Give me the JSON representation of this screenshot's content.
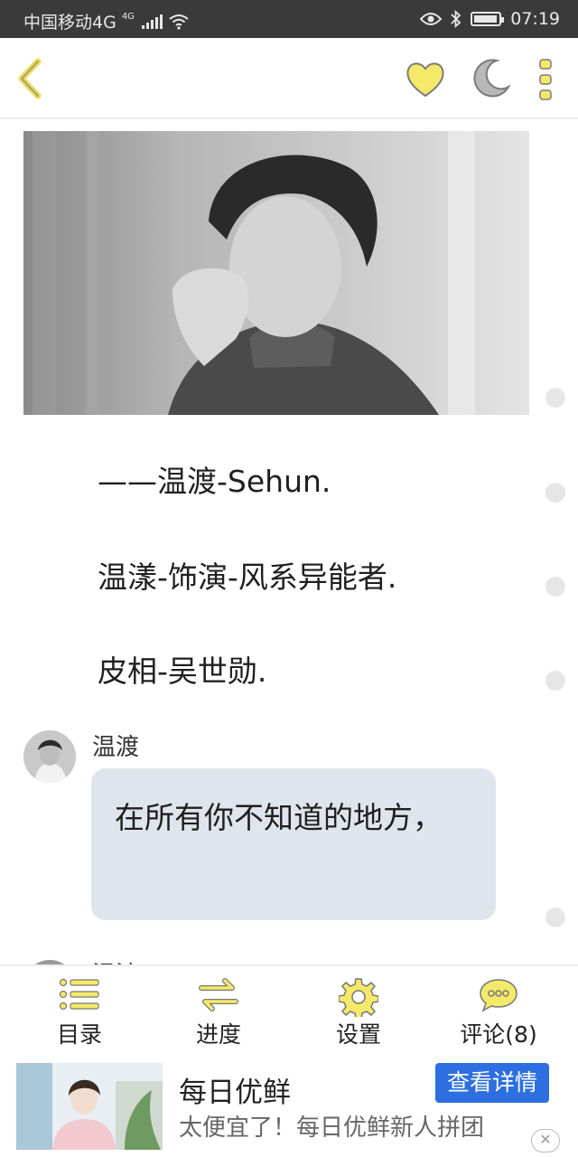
{
  "status_bar": {
    "carrier": "中国移动4G",
    "network_badge": "4G",
    "time": "07:19",
    "icons": [
      "signal-icon",
      "wifi-icon",
      "eye-icon",
      "bluetooth-icon",
      "battery-icon"
    ]
  },
  "toolbar": {
    "icons": [
      "back-icon",
      "heart-icon",
      "moon-icon",
      "more-icon"
    ],
    "accent_color": "#f5e96a"
  },
  "content": {
    "lines": [
      "——温渡-Sehun.",
      "温漾-饰演-风系异能者.",
      "皮相-吴世勋."
    ],
    "message": {
      "name": "温渡",
      "text": "在所有你不知道的地方，"
    },
    "next_message_name": "温渡"
  },
  "bottom_nav": {
    "items": [
      {
        "label": "目录",
        "icon": "catalog-icon"
      },
      {
        "label": "进度",
        "icon": "progress-icon"
      },
      {
        "label": "设置",
        "icon": "settings-icon"
      },
      {
        "label": "评论(8)",
        "icon": "comment-icon"
      }
    ]
  },
  "ad": {
    "title": "每日优鲜",
    "description": "太便宜了！每日优鲜新人拼团",
    "button_label": "查看详情",
    "close_label": "✕",
    "button_color": "#2d6fe0"
  }
}
